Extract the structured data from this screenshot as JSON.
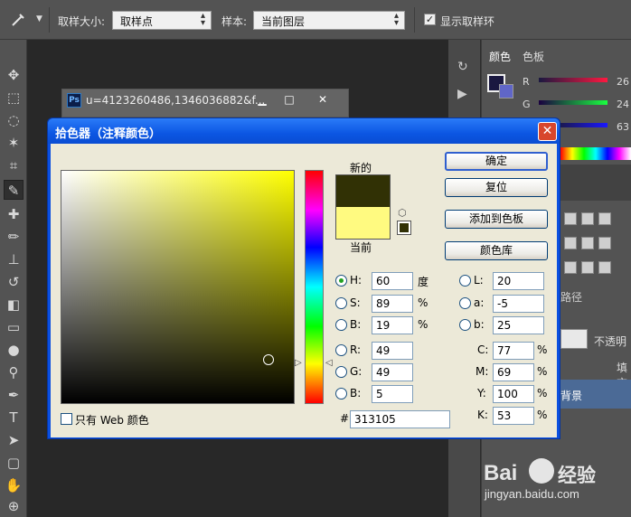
{
  "options_bar": {
    "sample_size_label": "取样大小:",
    "sample_size_value": "取样点",
    "sample_label": "样本:",
    "sample_value": "当前图层",
    "show_ring_checked": "✓",
    "show_ring_label": "显示取样环"
  },
  "doc_window": {
    "icon": "Ps",
    "title": "u=4123260486,1346036882&f...",
    "minimize": "▁",
    "maximize": "□",
    "close": "✕"
  },
  "right_panel": {
    "tab_color": "颜色",
    "tab_swatches": "色板",
    "r_value": "26",
    "g_value": "24",
    "b_value": "63",
    "paths_tab": "路径",
    "opacity_label": "不透明",
    "fill_label": "填充",
    "bg_layer_label": "背景",
    "r_label": "R",
    "g_label": "G",
    "b_label": "B"
  },
  "dialog": {
    "title": "拾色器（注释颜色）",
    "close": "✕",
    "new_label": "新的",
    "current_label": "当前",
    "new_color": "#313105",
    "current_color": "#fffa80",
    "buttons": {
      "ok": "确定",
      "reset": "复位",
      "add_to_swatches": "添加到色板",
      "color_libraries": "颜色库"
    },
    "hsb": {
      "h_label": "H:",
      "h_value": "60",
      "h_unit": "度",
      "s_label": "S:",
      "s_value": "89",
      "s_unit": "%",
      "b_label": "B:",
      "b_value": "19",
      "b_unit": "%"
    },
    "rgb": {
      "r_label": "R:",
      "r_value": "49",
      "g_label": "G:",
      "g_value": "49",
      "b_label": "B:",
      "b_value": "5"
    },
    "lab": {
      "l_label": "L:",
      "l_value": "20",
      "a_label": "a:",
      "a_value": "-5",
      "b_label": "b:",
      "b_value": "25"
    },
    "cmyk": {
      "c_label": "C:",
      "c_value": "77",
      "c_unit": "%",
      "m_label": "M:",
      "m_value": "69",
      "m_unit": "%",
      "y_label": "Y:",
      "y_value": "100",
      "y_unit": "%",
      "k_label": "K:",
      "k_value": "53",
      "k_unit": "%"
    },
    "hex_label": "#",
    "hex_value": "313105",
    "web_only_label": "只有 Web 颜色",
    "field_hue_color": "#ffff00"
  },
  "watermark": {
    "logo_text": "Bai",
    "logo_cn": "经验",
    "url": "jingyan.baidu.com"
  }
}
